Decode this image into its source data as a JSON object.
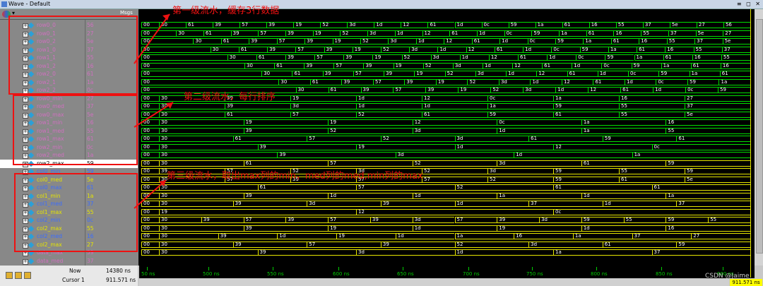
{
  "window": {
    "title": "Wave - Default",
    "buttons": "≡ ◻ ✕"
  },
  "header": {
    "msgs_label": "Msgs"
  },
  "signals": [
    {
      "name": "row0_0",
      "value": "56"
    },
    {
      "name": "row0_1",
      "value": "27"
    },
    {
      "name": "row0_2",
      "value": "5e"
    },
    {
      "name": "row1_0",
      "value": "37"
    },
    {
      "name": "row1_1",
      "value": "55"
    },
    {
      "name": "row1_2",
      "value": "16"
    },
    {
      "name": "row2_0",
      "value": "61"
    },
    {
      "name": "row2_1",
      "value": "1a"
    },
    {
      "name": "row2_2",
      "value": "0c"
    },
    {
      "name": "row0_min",
      "value": "27"
    },
    {
      "name": "row0_med",
      "value": "37"
    },
    {
      "name": "row0_max",
      "value": "5e"
    },
    {
      "name": "row1_min",
      "value": "16"
    },
    {
      "name": "row1_med",
      "value": "55"
    },
    {
      "name": "row1_max",
      "value": "61"
    },
    {
      "name": "row2_min",
      "value": "0c"
    },
    {
      "name": "row2_med",
      "value": "1a"
    },
    {
      "name": "row2_max",
      "value": "59"
    },
    {
      "name": "col0_min",
      "value": "59"
    },
    {
      "name": "col0_med",
      "value": "5e"
    },
    {
      "name": "col0_max",
      "value": "61"
    },
    {
      "name": "col1_min",
      "value": "1a"
    },
    {
      "name": "col1_med",
      "value": "37"
    },
    {
      "name": "col1_max",
      "value": "55"
    },
    {
      "name": "col2_min",
      "value": "0c"
    },
    {
      "name": "col2_max",
      "value": "55"
    },
    {
      "name": "col2_med",
      "value": "16"
    },
    {
      "name": "col2_max",
      "value": "27"
    },
    {
      "name": "data_max",
      "value": "59"
    },
    {
      "name": "data_med",
      "value": "37"
    }
  ],
  "waves": [
    [
      "00",
      "30",
      "61",
      "39",
      "57",
      "39",
      "19",
      "52",
      "3d",
      "1d",
      "12",
      "61",
      "1d",
      "0c",
      "59",
      "1a",
      "61",
      "16",
      "55",
      "37",
      "5e",
      "27",
      "56"
    ],
    [
      "00",
      "30",
      "61",
      "39",
      "57",
      "39",
      "19",
      "52",
      "3d",
      "1d",
      "12",
      "61",
      "1d",
      "0c",
      "59",
      "1a",
      "61",
      "16",
      "55",
      "37",
      "5e",
      "27"
    ],
    [
      "00",
      "30",
      "61",
      "39",
      "57",
      "39",
      "19",
      "52",
      "3d",
      "1d",
      "12",
      "61",
      "1d",
      "0c",
      "59",
      "1a",
      "61",
      "16",
      "55",
      "37",
      "5e"
    ],
    [
      "00",
      "30",
      "61",
      "39",
      "57",
      "39",
      "19",
      "52",
      "3d",
      "1d",
      "12",
      "61",
      "1d",
      "0c",
      "59",
      "1a",
      "61",
      "16",
      "55",
      "37"
    ],
    [
      "00",
      "30",
      "61",
      "39",
      "57",
      "39",
      "19",
      "52",
      "3d",
      "1d",
      "12",
      "61",
      "1d",
      "0c",
      "59",
      "1a",
      "61",
      "16",
      "55"
    ],
    [
      "00",
      "30",
      "61",
      "39",
      "57",
      "39",
      "19",
      "52",
      "3d",
      "1d",
      "12",
      "61",
      "1d",
      "0c",
      "59",
      "1a",
      "61",
      "16"
    ],
    [
      "00",
      "30",
      "61",
      "39",
      "57",
      "39",
      "19",
      "52",
      "3d",
      "1d",
      "12",
      "61",
      "1d",
      "0c",
      "59",
      "1a",
      "61"
    ],
    [
      "00",
      "30",
      "61",
      "39",
      "57",
      "39",
      "19",
      "52",
      "3d",
      "1d",
      "12",
      "61",
      "1d",
      "0c",
      "59",
      "1a"
    ],
    [
      "00",
      "30",
      "61",
      "39",
      "57",
      "39",
      "19",
      "52",
      "3d",
      "1d",
      "12",
      "61",
      "1d",
      "0c",
      "59"
    ],
    [
      "00",
      "30",
      "39",
      "19",
      "1d",
      "12",
      "0c",
      "1a",
      "16",
      "27"
    ],
    [
      "00",
      "30",
      "39",
      "3d",
      "1d",
      "1d",
      "1a",
      "59",
      "55",
      "37"
    ],
    [
      "00",
      "30",
      "61",
      "57",
      "52",
      "61",
      "59",
      "61",
      "55",
      "5e"
    ],
    [
      "00",
      "30",
      "19",
      "19",
      "12",
      "0c",
      "1a",
      "16"
    ],
    [
      "00",
      "30",
      "39",
      "52",
      "3d",
      "1d",
      "1a",
      "55"
    ],
    [
      "00",
      "30",
      "61",
      "57",
      "52",
      "3d",
      "61",
      "59",
      "61"
    ],
    [
      "00",
      "30",
      "39",
      "19",
      "1d",
      "12",
      "0c"
    ],
    [
      "00",
      "30",
      "39",
      "3d",
      "1d",
      "1a"
    ],
    [
      "00",
      "30",
      "61",
      "57",
      "52",
      "3d",
      "61",
      "59"
    ],
    [
      "00",
      "39",
      "57",
      "52",
      "3d",
      "52",
      "3d",
      "59",
      "55",
      "59"
    ],
    [
      "00",
      "30",
      "57",
      "39",
      "57",
      "57",
      "52",
      "59",
      "61",
      "5e"
    ],
    [
      "00",
      "30",
      "61",
      "57",
      "52",
      "61",
      "61"
    ],
    [
      "00",
      "30",
      "39",
      "1d",
      "1d",
      "1a",
      "1d",
      "1a"
    ],
    [
      "00",
      "30",
      "39",
      "3d",
      "39",
      "1d",
      "37",
      "1d",
      "37"
    ],
    [
      "00",
      "19",
      "12",
      "0c"
    ],
    [
      "00",
      "30",
      "39",
      "57",
      "39",
      "57",
      "39",
      "3d",
      "57",
      "39",
      "3d",
      "59",
      "55",
      "59",
      "55"
    ],
    [
      "00",
      "30",
      "39",
      "19",
      "1d",
      "19",
      "1d",
      "16"
    ],
    [
      "00",
      "30",
      "39",
      "1d",
      "19",
      "1d",
      "1a",
      "16",
      "1a",
      "37",
      "27"
    ],
    [
      "00",
      "30",
      "39",
      "57",
      "39",
      "52",
      "3d",
      "61",
      "59"
    ],
    [
      "00",
      "30",
      "39",
      "3d",
      "1d",
      "1a",
      "37"
    ]
  ],
  "status": {
    "now_label": "Now",
    "now_value": "14380 ns",
    "cursor_label": "Cursor 1",
    "cursor_value": "911.571 ns",
    "cursor_box": "911.571 ns"
  },
  "ticks": [
    "50 ns",
    "500 ns",
    "550 ns",
    "600 ns",
    "650 ns",
    "700 ns",
    "750 ns",
    "800 ns",
    "850 ns",
    "900 ns"
  ],
  "annotations": {
    "stage1": "第一级流水，缓存3行数据",
    "stage2": "第二级流水，每行排序",
    "stage3": "第三级流水，取出max列的min，med列的med,min列的max"
  },
  "watermark": "CSDN @Jaime",
  "colors": {
    "green": "#00e000",
    "yellow": "#e6e600",
    "pink": "#d070c0",
    "blue": "#3a6cff"
  }
}
